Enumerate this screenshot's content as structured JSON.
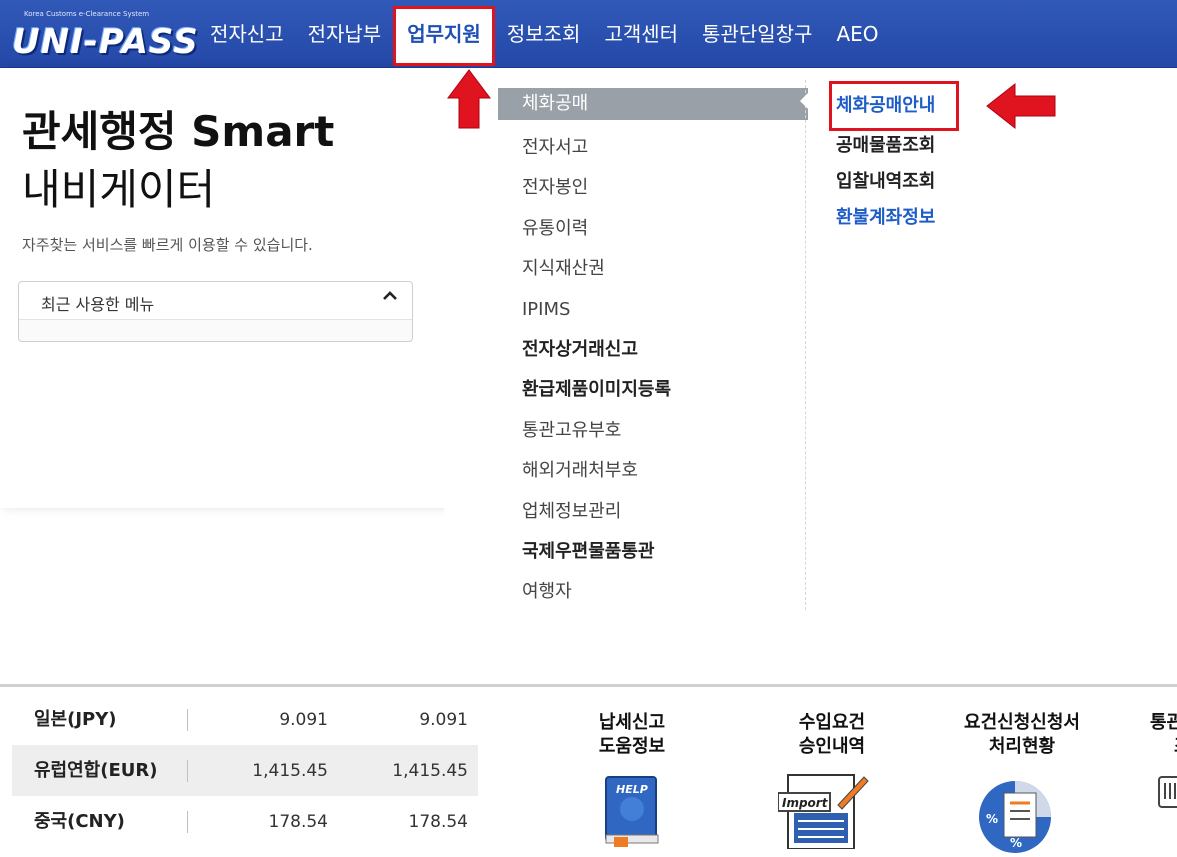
{
  "logo": {
    "subtitle": "Korea Customs e-Clearance System",
    "name": "UNI-PASS"
  },
  "nav": {
    "items": [
      "전자신고",
      "전자납부",
      "업무지원",
      "정보조회",
      "고객센터",
      "통관단일창구",
      "AEO"
    ],
    "active": "업무지원"
  },
  "sidebar": {
    "title_bold": "관세행정 Smart",
    "title_light": "내비게이터",
    "description": "자주찾는 서비스를 빠르게 이용할 수 있습니다.",
    "recent_label": "최근 사용한 메뉴"
  },
  "menu": {
    "items": [
      {
        "label": "체화공매",
        "style": "selected"
      },
      {
        "label": "전자서고",
        "style": "normal"
      },
      {
        "label": "전자봉인",
        "style": "normal"
      },
      {
        "label": "유통이력",
        "style": "normal"
      },
      {
        "label": "지식재산권",
        "style": "normal"
      },
      {
        "label": "IPIMS",
        "style": "normal"
      },
      {
        "label": "전자상거래신고",
        "style": "bold"
      },
      {
        "label": "환급제품이미지등록",
        "style": "bold"
      },
      {
        "label": "통관고유부호",
        "style": "normal"
      },
      {
        "label": "해외거래처부호",
        "style": "normal"
      },
      {
        "label": "업체정보관리",
        "style": "normal"
      },
      {
        "label": "국제우편물품통관",
        "style": "bold"
      },
      {
        "label": "여행자",
        "style": "normal"
      }
    ]
  },
  "submenu": {
    "items": [
      {
        "label": "체화공매안내",
        "color": "blue"
      },
      {
        "label": "공매물품조회",
        "color": "dark"
      },
      {
        "label": "입찰내역조회",
        "color": "dark"
      },
      {
        "label": "환불계좌정보",
        "color": "blue"
      }
    ]
  },
  "rates": [
    {
      "name": "일본(JPY)",
      "v1": "9.091",
      "v2": "9.091"
    },
    {
      "name": "유럽연합(EUR)",
      "v1": "1,415.45",
      "v2": "1,415.45"
    },
    {
      "name": "중국(CNY)",
      "v1": "178.54",
      "v2": "178.54"
    }
  ],
  "shortcuts": [
    {
      "line1": "납세신고",
      "line2": "도움정보",
      "icon": "help-book-icon",
      "icon_text": "HELP"
    },
    {
      "line1": "수입요건",
      "line2": "승인내역",
      "icon": "import-document-icon",
      "icon_text": "Import"
    },
    {
      "line1": "요건신청신청서",
      "line2": "처리현황",
      "icon": "pie-chart-icon",
      "icon_text": "%"
    },
    {
      "line1": "통관",
      "line2": "조",
      "icon": "barcode-icon"
    }
  ],
  "colors": {
    "nav_bg": "#2a50b0",
    "highlight_red": "#e0141e",
    "link_blue": "#1e5cc8",
    "selected_gray": "#9aa0a8"
  }
}
